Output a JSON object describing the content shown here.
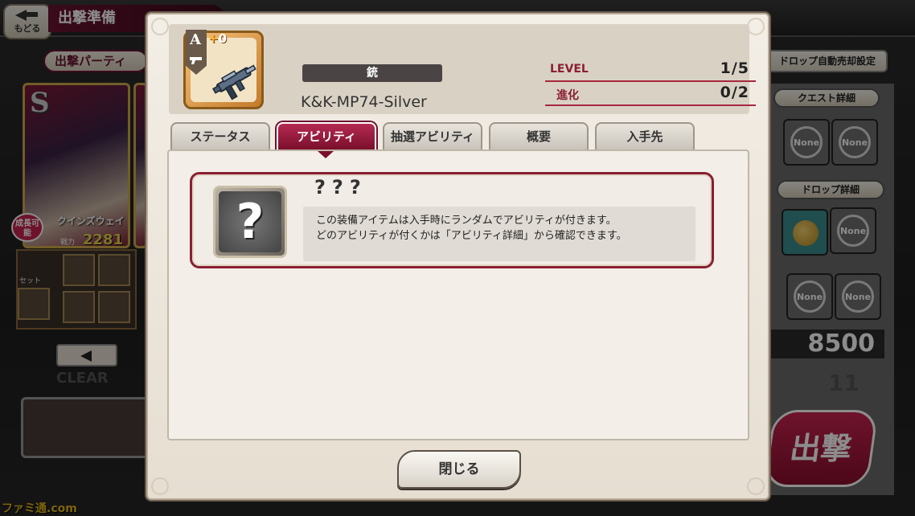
{
  "background": {
    "back_button_label": "もどる",
    "screen_title": "出撃準備",
    "party_label": "出撃パーティ",
    "auto_sell_label": "ドロップ自動売却設定",
    "quest_detail_label": "クエスト詳細",
    "drop_detail_label": "ドロップ詳細",
    "none_label": "None",
    "card": {
      "rank": "S",
      "name": "クインズウェイ",
      "power_label": "戦力",
      "power_value": "2281",
      "growth_badge": "成長可能",
      "set_label": "セット"
    },
    "clear_label": "CLEAR",
    "score": "8500",
    "count": "11",
    "sortie_label": "出撃",
    "watermark": "ファミ通.com"
  },
  "modal": {
    "item": {
      "rarity_letter": "A",
      "plus_value": "0",
      "category": "銃",
      "name": "K&K-MP74-Silver",
      "icon": "submachine-gun-icon"
    },
    "stats": [
      {
        "label": "LEVEL",
        "value": "1/5"
      },
      {
        "label": "進化",
        "value": "0/2"
      }
    ],
    "tabs": [
      {
        "label": "ステータス",
        "active": false
      },
      {
        "label": "アビリティ",
        "active": true
      },
      {
        "label": "抽選アビリティ",
        "active": false
      },
      {
        "label": "概要",
        "active": false
      },
      {
        "label": "入手先",
        "active": false
      }
    ],
    "ability": {
      "icon_glyph": "?",
      "name": "???",
      "description_line1": "この装備アイテムは入手時にランダムでアビリティが付きます。",
      "description_line2": "どのアビリティが付くかは「アビリティ詳細」から確認できます。"
    },
    "close_label": "閉じる"
  },
  "colors": {
    "accent": "#8a1f33",
    "tab_active": "#a0203f",
    "gold": "#e8d24a"
  }
}
